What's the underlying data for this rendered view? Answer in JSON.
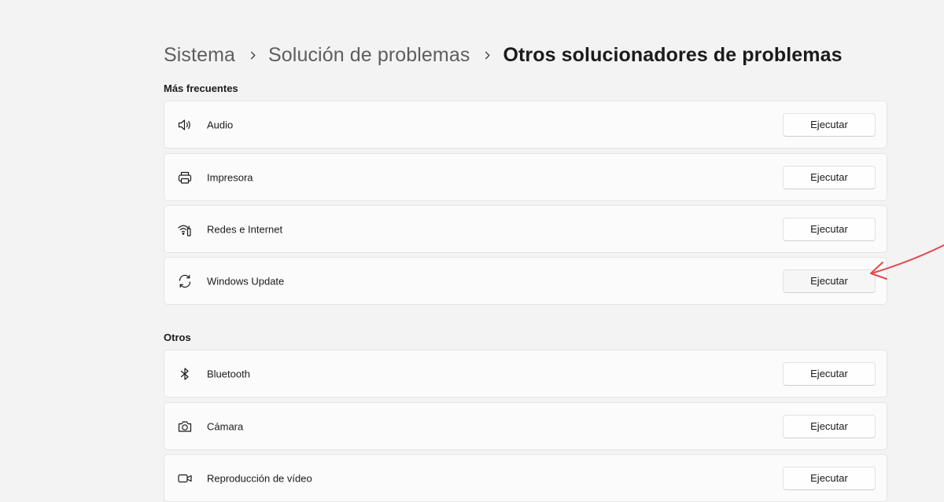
{
  "breadcrumb": {
    "items": [
      "Sistema",
      "Solución de problemas",
      "Otros solucionadores de problemas"
    ]
  },
  "sections": [
    {
      "title": "Más frecuentes",
      "items": [
        {
          "label": "Audio",
          "icon": "speaker-icon",
          "button": "Ejecutar"
        },
        {
          "label": "Impresora",
          "icon": "printer-icon",
          "button": "Ejecutar"
        },
        {
          "label": "Redes e Internet",
          "icon": "network-icon",
          "button": "Ejecutar"
        },
        {
          "label": "Windows Update",
          "icon": "sync-icon",
          "button": "Ejecutar"
        }
      ]
    },
    {
      "title": "Otros",
      "items": [
        {
          "label": "Bluetooth",
          "icon": "bluetooth-icon",
          "button": "Ejecutar"
        },
        {
          "label": "Cámara",
          "icon": "camera-icon",
          "button": "Ejecutar"
        },
        {
          "label": "Reproducción de vídeo",
          "icon": "video-icon",
          "button": "Ejecutar"
        }
      ]
    }
  ],
  "annotation": {
    "color": "#e5484d",
    "icon": "arrow-annotation"
  }
}
